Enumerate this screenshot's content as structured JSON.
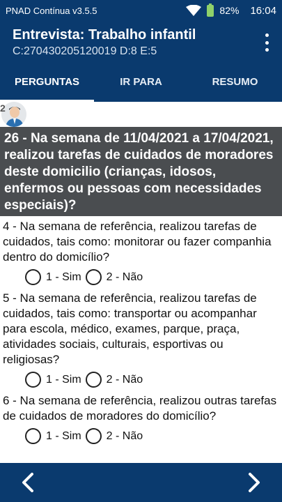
{
  "status_bar": {
    "app_version": "PNAD Contínua v3.5.5",
    "battery": "82%",
    "time": "16:04",
    "wifi_icon": "wifi-icon",
    "battery_icon": "battery-icon"
  },
  "header": {
    "title": "Entrevista: Trabalho infantil",
    "subtitle": "C:270430205120019 D:8 E:5",
    "menu_icon": "more-vert-icon"
  },
  "tabs": [
    {
      "label": "PERGUNTAS",
      "active": true
    },
    {
      "label": "IR PARA",
      "active": false
    },
    {
      "label": "RESUMO",
      "active": false
    }
  ],
  "respondent": {
    "number": "2",
    "avatar_icon": "person-avatar-icon"
  },
  "question": {
    "text": "26 - Na semana de 11/04/2021 a 17/04/2021, realizou tarefas de cuidados de moradores deste domicilio (crianças, idosos, enfermos ou pessoas com necessidades especiais)?"
  },
  "items": [
    {
      "text": "4 - Na semana de referência, realizou tarefas de cuidados, tais como: monitorar ou fazer companhia dentro do domicílio?",
      "options": [
        "1 - Sim",
        "2 - Não"
      ]
    },
    {
      "text": "5 - Na semana de referência, realizou tarefas de cuidados, tais como: transportar ou acompanhar para escola, médico, exames, parque, praça, atividades sociais, culturais, esportivas ou religiosas?",
      "options": [
        "1 - Sim",
        "2 - Não"
      ]
    },
    {
      "text": "6 - Na semana de referência, realizou outras tarefas de cuidados de moradores do domicílio?",
      "options": [
        "1 - Sim",
        "2 - Não"
      ]
    }
  ],
  "navigation": {
    "prev_icon": "chevron-left-icon",
    "next_icon": "chevron-right-icon"
  },
  "colors": {
    "primary": "#0a3a6e",
    "question_bg": "#4a4d50"
  }
}
